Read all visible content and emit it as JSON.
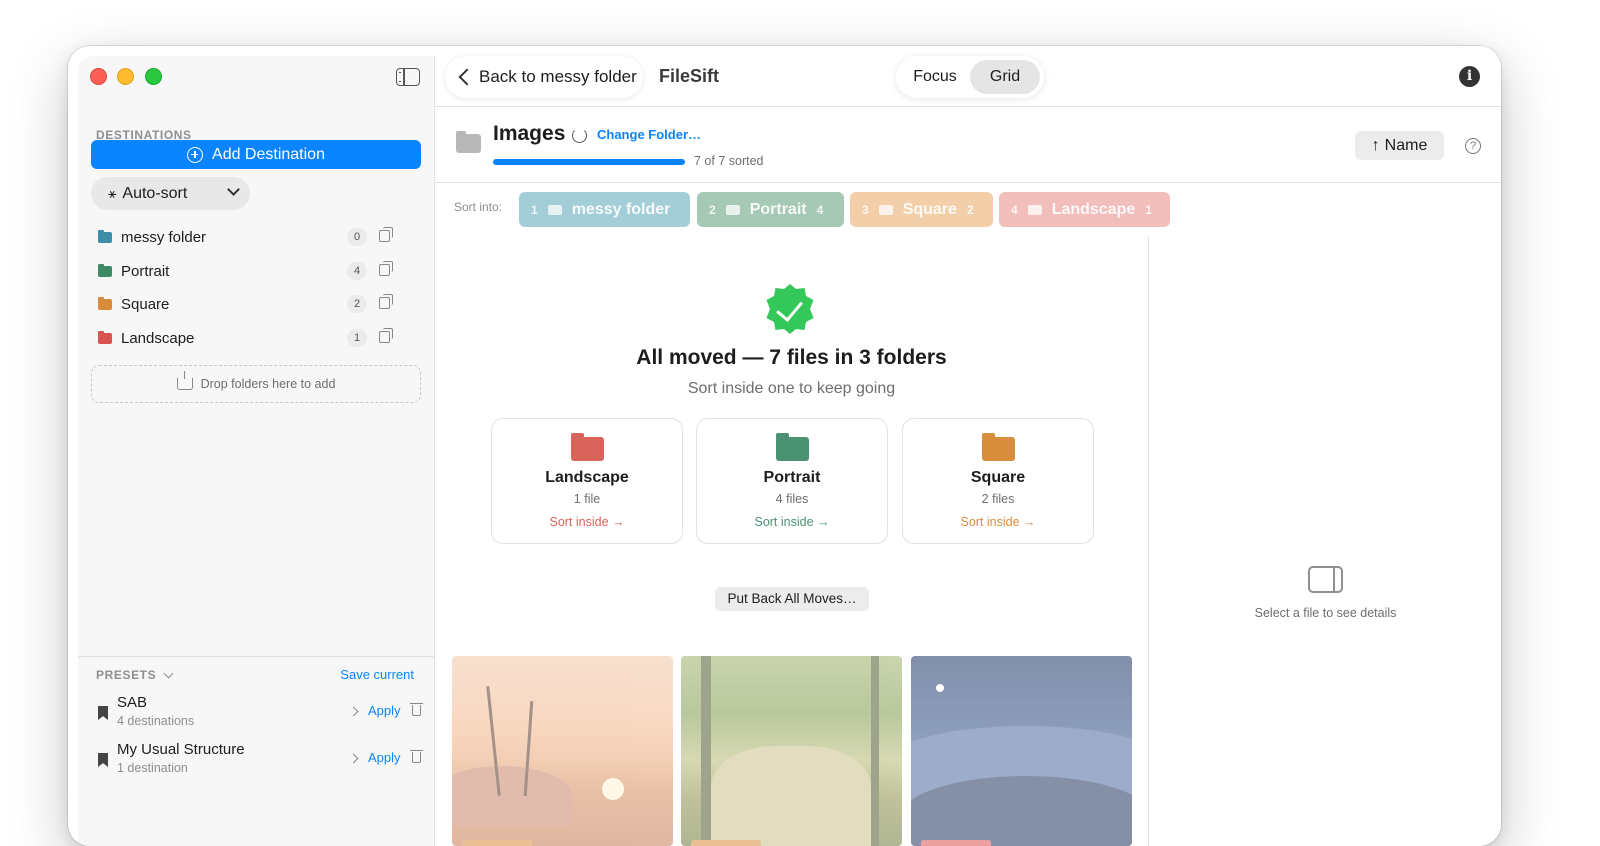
{
  "sidebar": {
    "destinations_label": "DESTINATIONS",
    "add_destination_label": "Add Destination",
    "autosort_label": "Auto-sort",
    "destinations": [
      {
        "name": "messy folder",
        "count": "0",
        "color": "#3d8ea6"
      },
      {
        "name": "Portrait",
        "count": "4",
        "color": "#3f8a66"
      },
      {
        "name": "Square",
        "count": "2",
        "color": "#d98a3a"
      },
      {
        "name": "Landscape",
        "count": "1",
        "color": "#d9534f"
      }
    ],
    "dropzone_label": "Drop folders here to add",
    "presets_label": "PRESETS",
    "save_current_label": "Save current",
    "presets": [
      {
        "name": "SAB",
        "sub": "4 destinations",
        "apply": "Apply"
      },
      {
        "name": "My Usual Structure",
        "sub": "1 destination",
        "apply": "Apply"
      }
    ]
  },
  "toolbar": {
    "back_label": "Back to messy folder",
    "app_title": "FileSift",
    "modes": [
      "Focus",
      "Grid"
    ],
    "active_mode": "Grid"
  },
  "header": {
    "folder_title": "Images",
    "change_folder_label": "Change Folder…",
    "progress_fraction": 1.0,
    "progress_text": "7 of 7 sorted",
    "sort_label": "Name"
  },
  "sort_into": {
    "label": "Sort into:",
    "chips": [
      {
        "num": "1",
        "name": "messy folder",
        "count": "",
        "color": "#5ba7b8"
      },
      {
        "num": "2",
        "name": "Portrait",
        "count": "4",
        "color": "#5f9d7c"
      },
      {
        "num": "3",
        "name": "Square",
        "count": "2",
        "color": "#eaa864"
      },
      {
        "num": "4",
        "name": "Landscape",
        "count": "1",
        "color": "#e98a86"
      }
    ]
  },
  "summary": {
    "title": "All moved — 7 files in 3 folders",
    "subtitle": "Sort inside one to keep going",
    "cards": [
      {
        "name": "Landscape",
        "count": "1 file",
        "link": "Sort inside →",
        "color": "#d9645c"
      },
      {
        "name": "Portrait",
        "count": "4 files",
        "link": "Sort inside →",
        "color": "#4a9273"
      },
      {
        "name": "Square",
        "count": "2 files",
        "link": "Sort inside →",
        "color": "#d98e3e"
      }
    ],
    "put_back_label": "Put Back All Moves…"
  },
  "details": {
    "empty_text": "Select a file to see details"
  }
}
